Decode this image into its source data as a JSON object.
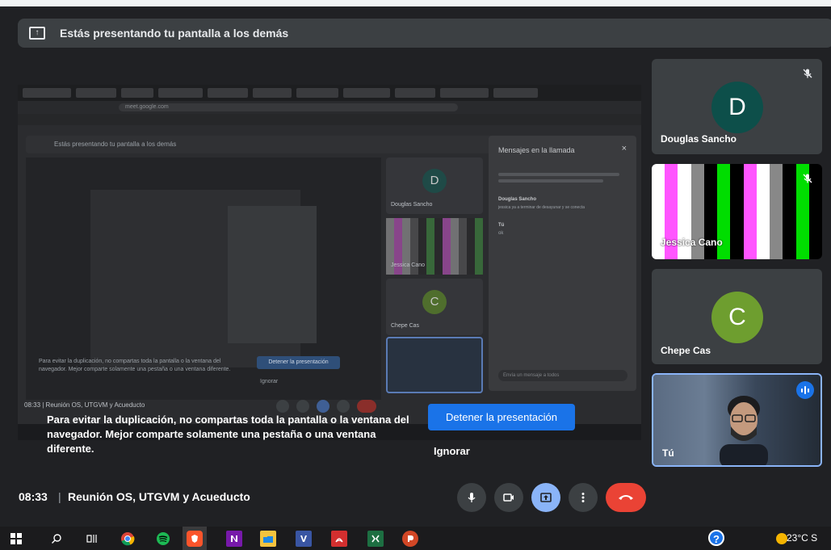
{
  "banner": {
    "text": "Estás presentando tu pantalla a los demás"
  },
  "shared": {
    "inner_banner": "Estás presentando tu pantalla a los demás",
    "url": "meet.google.com",
    "tiles": [
      {
        "name": "Douglas Sancho",
        "initial": "D"
      },
      {
        "name": "Jessica Cano"
      },
      {
        "name": "Chepe Cas",
        "initial": "C"
      }
    ],
    "chat": {
      "title": "Mensajes en la llamada",
      "close": "×",
      "input_placeholder": "Envía un mensaje a todos",
      "sender": "Douglas Sancho",
      "message": "jessica ya a terminar de desayunar y se conecta",
      "self_label": "Tú",
      "self_msg": "ok"
    },
    "warning": "Para evitar la duplicación, no compartas toda la pantalla o la ventana del navegador. Mejor comparte solamente una pestaña o una ventana diferente.",
    "stop": "Detener la presentación",
    "ignore": "Ignorar",
    "bottom": "08:33  |  Reunión OS, UTGVM y Acueducto"
  },
  "overlay": {
    "warning": "Para evitar la duplicación, no compartas toda la pantalla o la ventana del navegador. Mejor comparte solamente una pestaña o una ventana diferente.",
    "stop_label": "Detener la presentación",
    "ignore_label": "Ignorar"
  },
  "participants": [
    {
      "name": "Douglas Sancho",
      "initial": "D",
      "avatar_color": "#0d4f4a",
      "muted": true
    },
    {
      "name": "Jessica Cano",
      "muted": true,
      "stripes": [
        "#ffffff",
        "#ff55ff",
        "#ffffff",
        "#888888",
        "#000000",
        "#00dd00",
        "#000000",
        "#ff55ff",
        "#ffffff",
        "#888888",
        "#000000",
        "#00dd00",
        "#000000"
      ]
    },
    {
      "name": "Chepe Cas",
      "initial": "C",
      "avatar_color": "#6e9e2f",
      "muted": false
    }
  ],
  "self": {
    "name": "Tú",
    "speaking": true
  },
  "meeting": {
    "time": "08:33",
    "separator": "|",
    "name": "Reunión OS, UTGVM y Acueducto"
  },
  "controls": [
    "mic-icon",
    "camera-icon",
    "present-icon",
    "more-icon",
    "end-call-icon"
  ],
  "taskbar": {
    "weather": "23°C  S",
    "help": "?",
    "apps": [
      "windows-icon",
      "search-icon",
      "task-view-icon",
      "chrome-icon",
      "spotify-icon",
      "brave-icon",
      "onenote-icon",
      "explorer-icon",
      "visio-icon",
      "acrobat-icon",
      "excel-icon",
      "powerpoint-icon"
    ]
  },
  "colors": {
    "accent": "#1a73e8",
    "end_call": "#ea4335",
    "present": "#8ab4f8",
    "background": "#202124",
    "tile": "#3c4043"
  }
}
